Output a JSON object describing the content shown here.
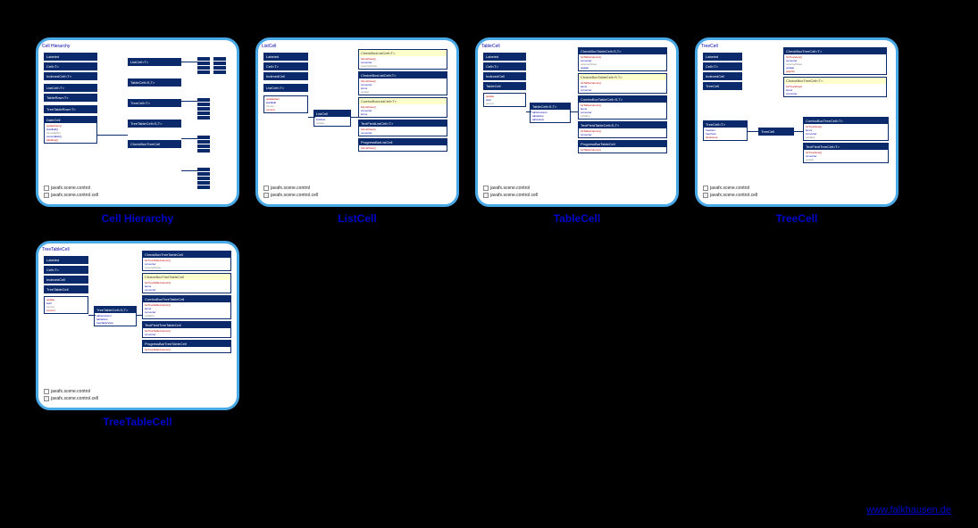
{
  "footer": "www.falkhausen.de",
  "cards": [
    {
      "title": "Cell Hierarchy",
      "legend1": "javafx.scene.control",
      "legend2": "javafx.scene.control.cell",
      "corner": "Cell Hierarchy"
    },
    {
      "title": "ListCell",
      "legend1": "javafx.scene.control",
      "legend2": "javafx.scene.control.cell",
      "corner": "ListCell"
    },
    {
      "title": "TableCell",
      "legend1": "javafx.scene.control",
      "legend2": "javafx.scene.control.cell",
      "corner": "TableCell"
    },
    {
      "title": "TreeCell",
      "legend1": "javafx.scene.control",
      "legend2": "javafx.scene.control.cell",
      "corner": "TreeCell"
    },
    {
      "title": "TreeTableCell",
      "legend1": "javafx.scene.control",
      "legend2": "javafx.scene.control.cell",
      "corner": "TreeTableCell"
    }
  ]
}
